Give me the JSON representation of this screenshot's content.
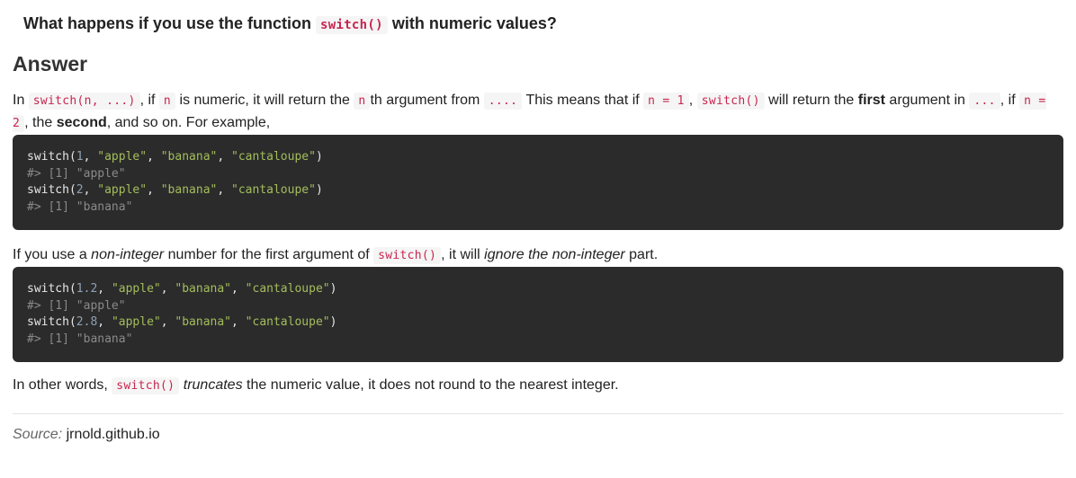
{
  "question": {
    "before": "What happens if you use the function ",
    "code": "switch()",
    "after": " with numeric values?"
  },
  "answer_heading": "Answer",
  "para1": {
    "t1": "In ",
    "c1": "switch(n, ...)",
    "t2": ", if ",
    "c2": "n",
    "t3": " is numeric, it will return the ",
    "c3": "n",
    "t4": "th argument from ",
    "c4": "....",
    "t5": " This means that if ",
    "c5": "n = 1",
    "t6": ", ",
    "c6": "switch()",
    "t7": " will return the ",
    "b1": "first",
    "t8": " argument in ",
    "c7": "...",
    "t9": ", if ",
    "c8": "n = 2",
    "t10": ", the ",
    "b2": "second",
    "t11": ", and so on. For example,"
  },
  "code_block_1": {
    "lines": [
      {
        "fn": "switch(",
        "num": "1",
        "args": [
          "\"apple\"",
          "\"banana\"",
          "\"cantaloupe\""
        ]
      },
      {
        "comment": "#> [1] \"apple\""
      },
      {
        "fn": "switch(",
        "num": "2",
        "args": [
          "\"apple\"",
          "\"banana\"",
          "\"cantaloupe\""
        ]
      },
      {
        "comment": "#> [1] \"banana\""
      }
    ]
  },
  "para2": {
    "t1": "If you use a ",
    "i1": "non-integer",
    "t2": " number for the first argument of ",
    "c1": "switch()",
    "t3": ", it will ",
    "i2": "ignore the non-integer",
    "t4": " part."
  },
  "code_block_2": {
    "lines": [
      {
        "fn": "switch(",
        "num": "1.2",
        "args": [
          "\"apple\"",
          "\"banana\"",
          "\"cantaloupe\""
        ]
      },
      {
        "comment": "#> [1] \"apple\""
      },
      {
        "fn": "switch(",
        "num": "2.8",
        "args": [
          "\"apple\"",
          "\"banana\"",
          "\"cantaloupe\""
        ]
      },
      {
        "comment": "#> [1] \"banana\""
      }
    ]
  },
  "para3": {
    "t1": "In other words, ",
    "c1": "switch()",
    "i1": "truncates",
    "t2": " the numeric value, it does not round to the nearest integer."
  },
  "source": {
    "label": "Source:",
    "link": "jrnold.github.io"
  }
}
